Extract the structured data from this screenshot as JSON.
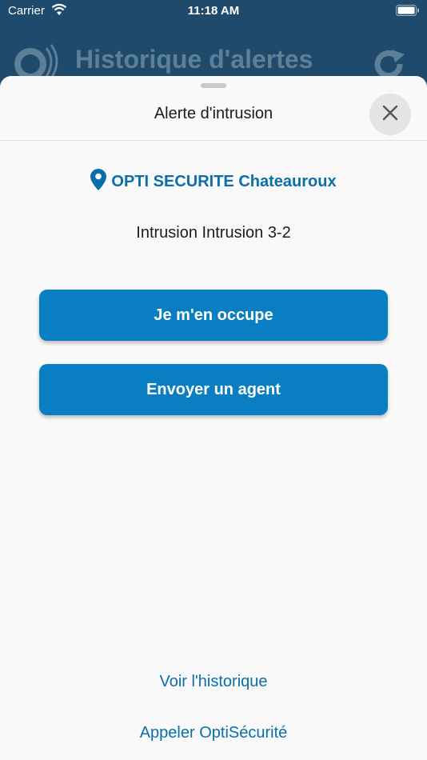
{
  "status_bar": {
    "carrier": "Carrier",
    "time": "11:18 AM"
  },
  "background": {
    "title": "Historique d'alertes"
  },
  "sheet": {
    "title": "Alerte d'intrusion",
    "location": "OPTI SECURITE Chateauroux",
    "detail": "Intrusion Intrusion 3-2",
    "actions": {
      "occupy_label": "Je m'en occupe",
      "send_agent_label": "Envoyer un agent"
    },
    "links": {
      "history": "Voir l'historique",
      "call": "Appeler OptiSécurité"
    }
  },
  "colors": {
    "accent": "#0a7ec2",
    "link": "#0a6fa8",
    "header_bg": "#1f4a6b",
    "sheet_bg": "#f9f9f9"
  },
  "icons": [
    "wifi-icon",
    "battery-icon",
    "app-logo-icon",
    "refresh-icon",
    "close-icon",
    "location-pin-icon"
  ]
}
